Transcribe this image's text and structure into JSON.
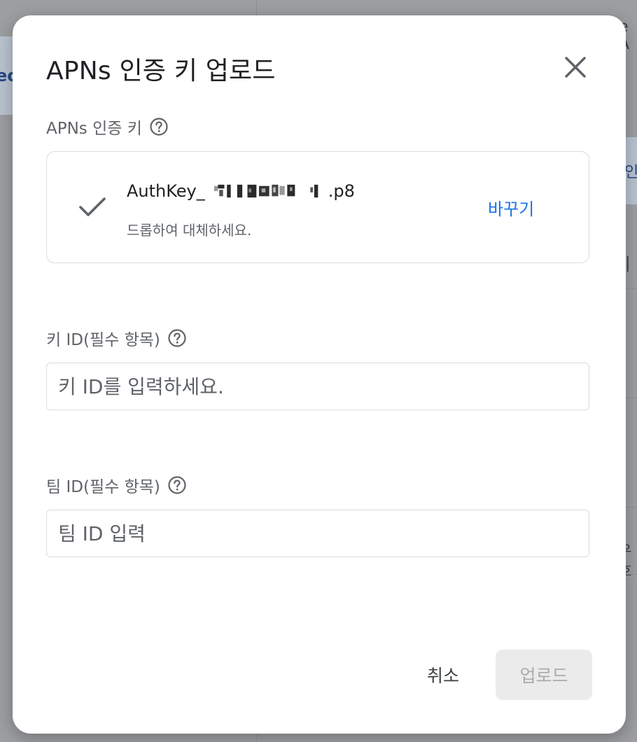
{
  "dialog": {
    "title": "APNs 인증 키 업로드",
    "close_icon": "close-icon",
    "auth_key": {
      "label": "APNs 인증 키",
      "help_icon": "help-circle-icon",
      "file_prefix": "AuthKey_",
      "file_suffix": ".p8",
      "hint": "드롭하여 대체하세요.",
      "replace_label": "바꾸기",
      "check_icon": "check-icon"
    },
    "key_id": {
      "label": "키 ID(필수 항목)",
      "placeholder": "키 ID를 입력하세요.",
      "value": ""
    },
    "team_id": {
      "label": "팀 ID(필수 항목)",
      "placeholder": "팀 ID 입력",
      "value": ""
    },
    "cancel_label": "취소",
    "upload_label": "업로드"
  },
  "background": {
    "left_text": "eo",
    "right_text_1": "e A",
    "right_text_2": "인",
    "right_text_3": "|",
    "right_text_4": "우호"
  },
  "colors": {
    "accent": "#1a73e8",
    "overlay": "#9c9ea1",
    "dialog_bg": "#ffffff",
    "disabled_button_bg": "#ebebeb"
  }
}
